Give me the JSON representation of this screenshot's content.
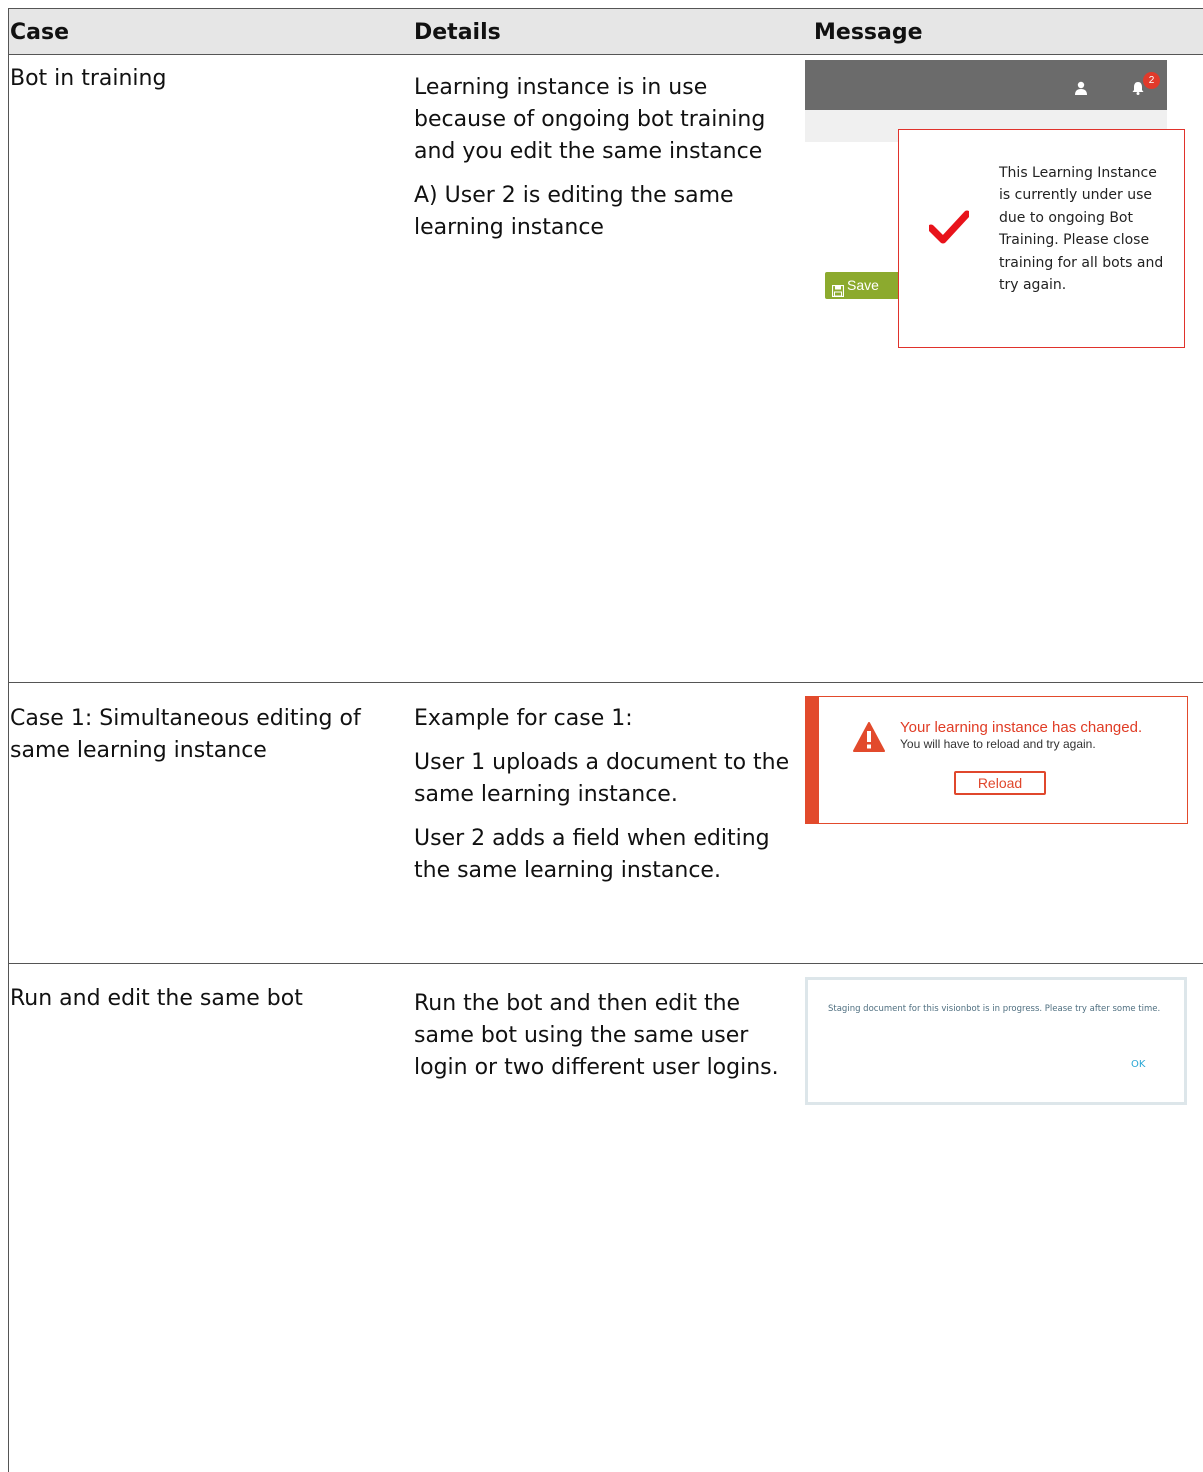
{
  "table": {
    "headers": [
      "Case",
      "Details",
      "Message"
    ],
    "rows": [
      {
        "case": "Bot in training",
        "details": [
          "Learning instance is in use because of ongoing bot training and you edit the same instance",
          "A) User 2 is editing the same learning instance"
        ]
      },
      {
        "case": "Case 1: Simultaneous editing of same learning instance",
        "details": [
          "Example for case 1:",
          "User 1 uploads a document to the same learning instance.",
          "User 2 adds a field when editing the same learning instance."
        ]
      },
      {
        "case": "Run and edit the same bot",
        "details": [
          "Run the bot and then edit the same bot using the same user login or two different user logins."
        ]
      }
    ]
  },
  "training_message": {
    "notification_count": "2",
    "save_label": "Save",
    "text": "This Learning Instance is currently under use due to ongoing Bot Training. Please close training for all bots and try again."
  },
  "changed_message": {
    "title": "Your learning instance has changed.",
    "subtitle": "You will have to reload and try again.",
    "reload_label": "Reload"
  },
  "staging_message": {
    "text": "Staging document for this visionbot is in progress. Please try after some time.",
    "ok_label": "OK"
  },
  "colors": {
    "header_bg": "#e6e6e6",
    "alert_red": "#e03a2b",
    "save_green": "#8caa2e",
    "link_blue": "#2aa7d5"
  }
}
